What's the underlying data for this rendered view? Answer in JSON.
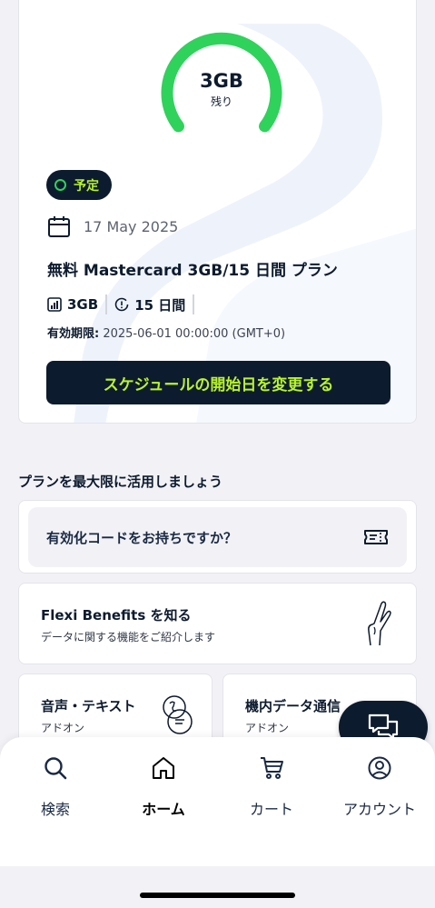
{
  "plan": {
    "data_remaining": "3GB",
    "remaining_label": "残り",
    "status": "予定",
    "date": "17 May 2025",
    "name": "無料 Mastercard 3GB/15 日間 プラン",
    "data": "3GB",
    "duration": "15 日間",
    "expiry_label": "有効期限:",
    "expiry_value": "2025-06-01 00:00:00 (GMT+0)",
    "change_button": "スケジュールの開始日を変更する",
    "gauge_fraction": 1.0
  },
  "section_title": "プランを最大限に活用しましょう",
  "code_card": {
    "label": "有効化コードをお持ちですか？"
  },
  "benefits": {
    "title": "Flexi Benefits を知る",
    "subtitle": "データに関する機能をご紹介します"
  },
  "addons": [
    {
      "title": "音声・テキスト",
      "subtitle": "アドオン"
    },
    {
      "title": "機内データ通信",
      "subtitle": "アドオン"
    }
  ],
  "nav": [
    {
      "label": "検索",
      "icon": "search-icon"
    },
    {
      "label": "ホーム",
      "icon": "home-icon",
      "active": true
    },
    {
      "label": "カート",
      "icon": "cart-icon"
    },
    {
      "label": "アカウント",
      "icon": "account-icon"
    }
  ],
  "colors": {
    "navy": "#0d1b2e",
    "lime": "#b8f42c",
    "green": "#2fd25b",
    "background": "#f2f2f6"
  }
}
